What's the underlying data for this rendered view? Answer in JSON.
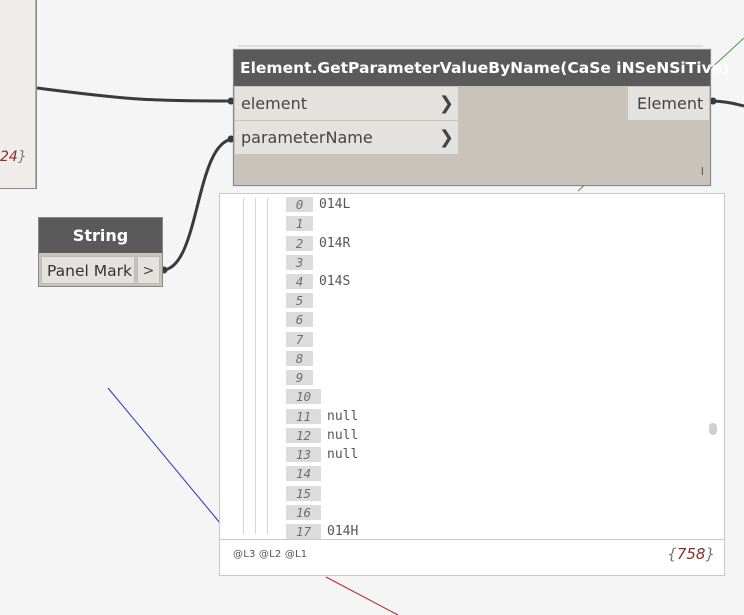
{
  "left_node": {
    "count": "24"
  },
  "node": {
    "title": "Element.GetParameterValueByName(CaSe iNSeNSiTive)",
    "inputs": [
      {
        "label": "element"
      },
      {
        "label": "parameterName"
      }
    ],
    "output": {
      "label": "Element"
    },
    "lacing": "I"
  },
  "string_node": {
    "title": "String",
    "value": "Panel Mark",
    "output_port": ">"
  },
  "preview": {
    "items": [
      {
        "index": "0",
        "value": "014L"
      },
      {
        "index": "1",
        "value": ""
      },
      {
        "index": "2",
        "value": "014R"
      },
      {
        "index": "3",
        "value": ""
      },
      {
        "index": "4",
        "value": "014S"
      },
      {
        "index": "5",
        "value": ""
      },
      {
        "index": "6",
        "value": ""
      },
      {
        "index": "7",
        "value": ""
      },
      {
        "index": "8",
        "value": ""
      },
      {
        "index": "9",
        "value": ""
      },
      {
        "index": "10",
        "value": ""
      },
      {
        "index": "11",
        "value": "null"
      },
      {
        "index": "12",
        "value": "null"
      },
      {
        "index": "13",
        "value": "null"
      },
      {
        "index": "14",
        "value": ""
      },
      {
        "index": "15",
        "value": ""
      },
      {
        "index": "16",
        "value": ""
      },
      {
        "index": "17",
        "value": "014H"
      }
    ],
    "levels": "@L3 @L2 @L1",
    "total": "758"
  },
  "colors": {
    "node_header": "#5a5a5a",
    "node_body": "#c8c4bc",
    "port_bg": "#e4e2de",
    "wire": "#3a3a3a",
    "count_text": "#8b2b2b"
  }
}
